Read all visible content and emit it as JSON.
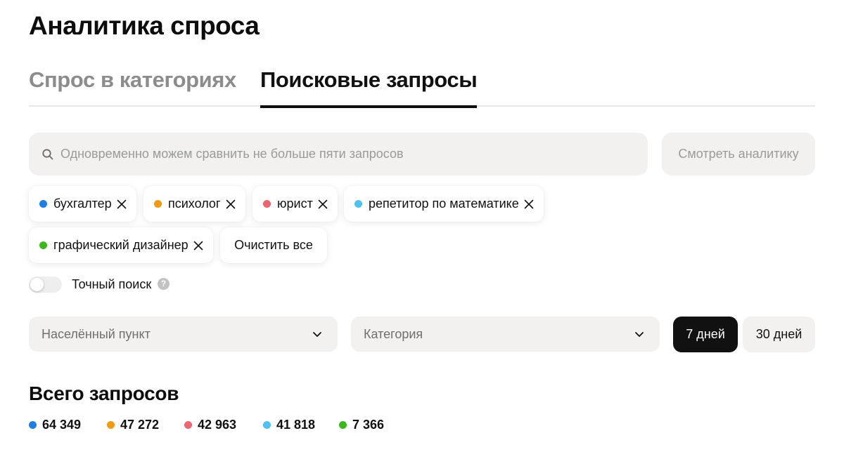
{
  "page": {
    "title": "Аналитика спроса"
  },
  "tabs": [
    {
      "label": "Спрос в категориях",
      "active": false
    },
    {
      "label": "Поисковые запросы",
      "active": true
    }
  ],
  "search": {
    "placeholder": "Одновременно можем сравнить не больше пяти запросов",
    "value": "",
    "icon": "search-icon"
  },
  "view_button": {
    "label": "Смотреть аналитику"
  },
  "queries": [
    {
      "label": "бухгалтер",
      "color": "#1e7ee4"
    },
    {
      "label": "психолог",
      "color": "#f39a14"
    },
    {
      "label": "юрист",
      "color": "#ec6570"
    },
    {
      "label": "репетитор по математике",
      "color": "#4fc0ef"
    },
    {
      "label": "графический дизайнер",
      "color": "#3cb71d"
    }
  ],
  "clear_all": {
    "label": "Очистить все"
  },
  "exact_search": {
    "label": "Точный поиск",
    "enabled": false,
    "help_icon": "?"
  },
  "filters": {
    "city": {
      "label": "Населённый пункт"
    },
    "category": {
      "label": "Категория"
    }
  },
  "period": {
    "options": [
      {
        "label": "7 дней",
        "active": true
      },
      {
        "label": "30 дней",
        "active": false
      }
    ]
  },
  "totals": {
    "title": "Всего запросов",
    "items": [
      {
        "value": "64 349",
        "color": "#1e7ee4"
      },
      {
        "value": "47 272",
        "color": "#f39a14"
      },
      {
        "value": "42 963",
        "color": "#ec6570"
      },
      {
        "value": "41 818",
        "color": "#4fc0ef"
      },
      {
        "value": "7 366",
        "color": "#3cb71d"
      }
    ]
  }
}
